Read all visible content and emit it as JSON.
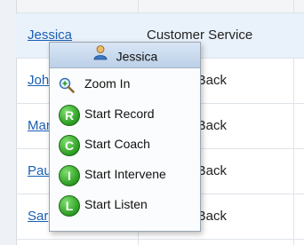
{
  "grid": {
    "rows": [
      {
        "name": "Jessica",
        "queue": "Customer Service"
      },
      {
        "name": "Joh",
        "queue": "sive CallBack"
      },
      {
        "name": "Mar",
        "queue": "sive CallBack"
      },
      {
        "name": "Pau",
        "queue": "sive CallBack"
      },
      {
        "name": "Sar",
        "queue": "sive CallBack"
      }
    ]
  },
  "context_menu": {
    "header": "Jessica",
    "items": [
      {
        "label": "Zoom In",
        "icon": "zoom-in-icon"
      },
      {
        "label": "Start Record",
        "icon": "record-icon",
        "badge": "R"
      },
      {
        "label": "Start Coach",
        "icon": "coach-icon",
        "badge": "C"
      },
      {
        "label": "Start Intervene",
        "icon": "intervene-icon",
        "badge": "I"
      },
      {
        "label": "Start Listen",
        "icon": "listen-icon",
        "badge": "L"
      }
    ]
  },
  "colors": {
    "accent": "#2c9c22",
    "link": "#1a5fb4"
  }
}
